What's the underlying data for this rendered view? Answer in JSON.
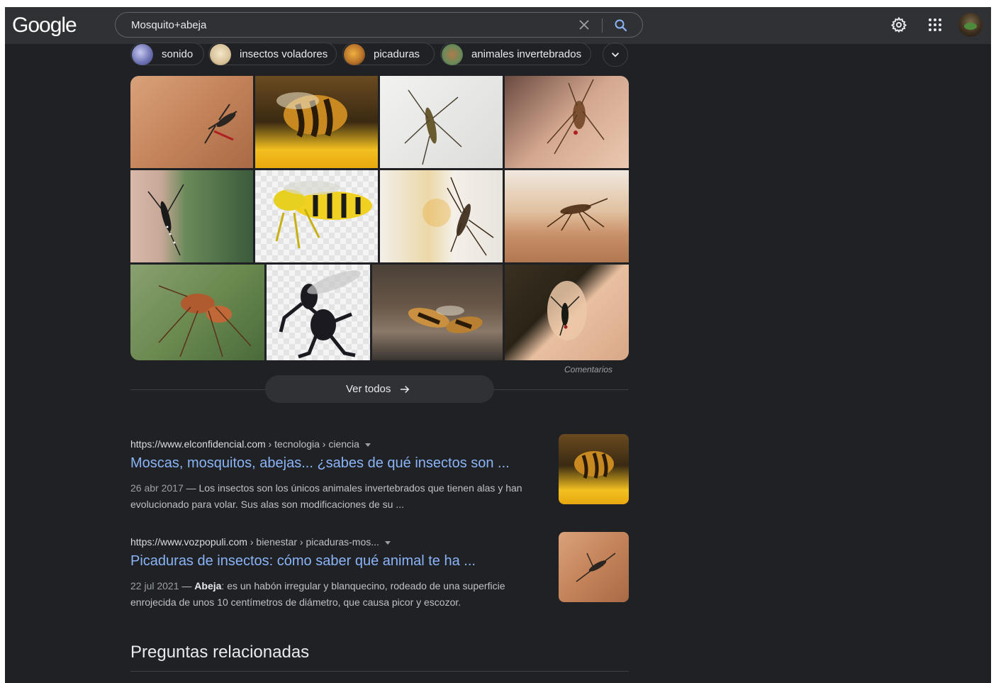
{
  "header": {
    "logo": "Google",
    "search_query": "Mosquito+abeja"
  },
  "chips": [
    {
      "label": "sonido",
      "thumb": "#8a90c8"
    },
    {
      "label": "insectos voladores",
      "thumb": "#d8c9a6"
    },
    {
      "label": "picaduras",
      "thumb": "#b8742a"
    },
    {
      "label": "animales invertebrados",
      "thumb": "#6a8a5a"
    }
  ],
  "images": {
    "feedback_label": "Comentarios",
    "see_all_label": "Ver todos"
  },
  "results": [
    {
      "url_base": "https://www.elconfidencial.com",
      "url_path": " › tecnologia › ciencia",
      "title": "Moscas, mosquitos, abejas... ¿sabes de qué insectos son ...",
      "date": "26 abr 2017",
      "snippet_sep": " — ",
      "snippet_bold": "",
      "snippet": "Los insectos son los únicos animales invertebrados que tienen alas y han evolucionado para volar. Sus alas son modificaciones de su ..."
    },
    {
      "url_base": "https://www.vozpopuli.com",
      "url_path": " › bienestar › picaduras-mos...",
      "title": "Picaduras de insectos: cómo saber qué animal te ha ...",
      "date": "22 jul 2021",
      "snippet_sep": " — ",
      "snippet_bold": "Abeja",
      "snippet": ": es un habón irregular y blanquecino, rodeado de una superficie enrojecida de unos 10 centímetros de diámetro, que causa picor y escozor."
    }
  ],
  "related": {
    "heading": "Preguntas relacionadas"
  },
  "colors": {
    "background": "#202124",
    "header": "#303134",
    "link": "#8ab4f8",
    "text": "#e8eaed"
  }
}
